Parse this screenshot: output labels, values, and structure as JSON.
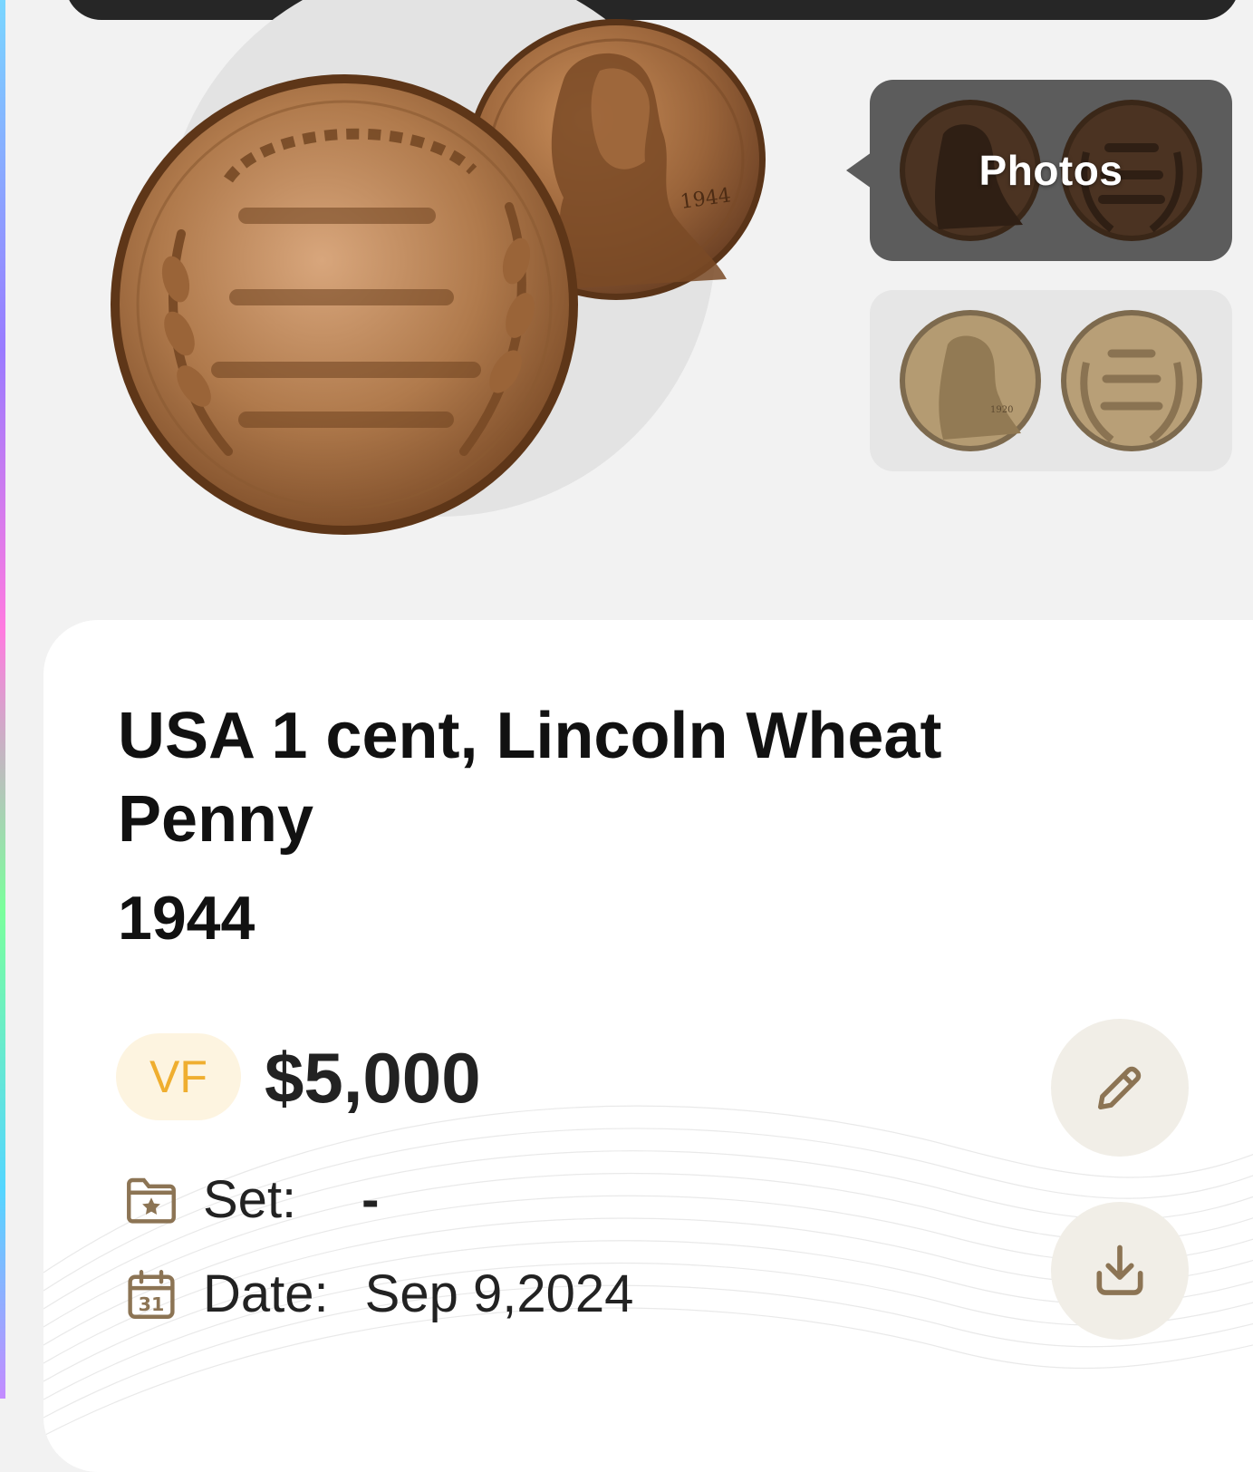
{
  "gallery": {
    "photos_label": "Photos",
    "thumbnails": [
      {
        "name": "user-photos",
        "selected": true
      },
      {
        "name": "reference-photos",
        "selected": false
      }
    ]
  },
  "hero_coin": {
    "obverse_date": "1944"
  },
  "reference_coin": {
    "obverse_date": "1920"
  },
  "coin_details": {
    "title": "USA 1 cent, Lincoln Wheat Penny",
    "year": "1944",
    "grade": "VF",
    "price": "$5,000",
    "set_label": "Set:",
    "set_value": "-",
    "date_label": "Date:",
    "date_value": "Sep 9,2024",
    "calendar_day": "31"
  },
  "icons": {
    "edit": "pencil-icon",
    "download": "download-icon",
    "set": "folder-star-icon",
    "date": "calendar-icon"
  },
  "colors": {
    "grade_text": "#efae2f",
    "grade_bg": "#fdf4e0",
    "icon_brown": "#8c7454",
    "button_bg": "#f1eee7"
  }
}
